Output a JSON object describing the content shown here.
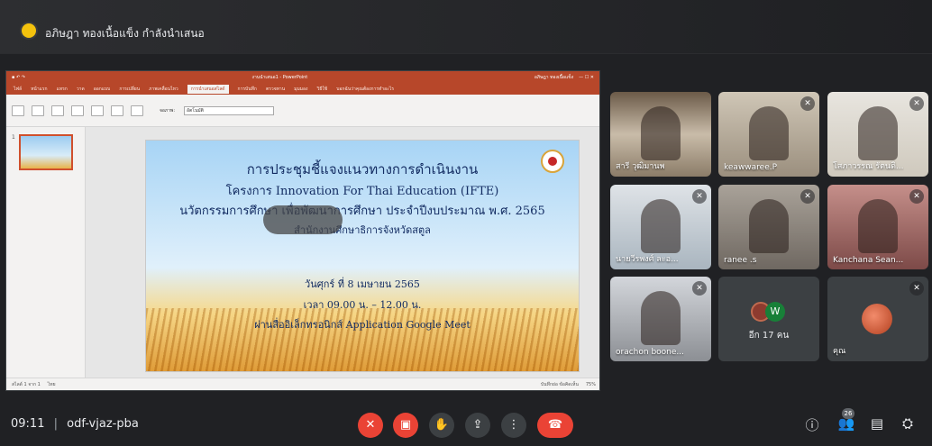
{
  "banner": {
    "presenter_text": "อภิษฎา ทองเนื้อแข็ง กำลังนำเสนอ"
  },
  "powerpoint": {
    "title": "งานนำเสนอ1 - PowerPoint",
    "user": "อภิษฎา ทองเนื้อแข็ง",
    "tabs": [
      "ไฟล์",
      "หน้าแรก",
      "แทรก",
      "วาด",
      "ออกแบบ",
      "การเปลี่ยน",
      "ภาพเคลื่อนไหว",
      "การนำเสนอสไลด์",
      "การบันทึก",
      "ตรวจทาน",
      "มุมมอง",
      "วิธีใช้",
      "บอกฉันว่าคุณต้องการทำอะไร"
    ],
    "ribbon_select_label": "จอภาพ:",
    "ribbon_select_value": "อัตโนมัติ",
    "thumbnail_number": "1",
    "status_left": "สไลด์ 1 จาก 1",
    "status_lang": "ไทย",
    "status_right": "บันทึกย่อ  ข้อคิดเห็น",
    "zoom": "75%"
  },
  "slide": {
    "line1": "การประชุมชี้แจงแนวทางการดำเนินงาน",
    "line2": "โครงการ Innovation For Thai Education (IFTE)",
    "line3": "นวัตกรรมการศึกษา เพื่อพัฒนาการศึกษา ประจำปีงบประมาณ พ.ศ. 2565",
    "line4": "สำนักงานศึกษาธิการจังหวัดสตูล",
    "line5": "วันศุกร์ ที่ 8 เมษายน 2565",
    "line6": "เวลา 09.00 น. – 12.00 น.",
    "line7": "ผ่านสื่ออิเล็กทรอนิกส์ Application Google Meet"
  },
  "participants": [
    {
      "name": "สารี วุฒิมานพ",
      "muted": false
    },
    {
      "name": "keawwaree.P",
      "muted": true
    },
    {
      "name": "โสภาวรรณ รัตนดิ...",
      "muted": true
    },
    {
      "name": "นายวีรพงศ์ ละอ...",
      "muted": true
    },
    {
      "name": "ranee .s",
      "muted": true
    },
    {
      "name": "Kanchana Sean...",
      "muted": true
    },
    {
      "name": "orachon boone...",
      "muted": true
    },
    {
      "name": "อีก 17 คน",
      "muted": false,
      "avatar_letter": "W"
    },
    {
      "name": "คุณ",
      "muted": true
    }
  ],
  "bottom_bar": {
    "time": "09:11",
    "separator": "|",
    "meeting_code": "odf-vjaz-pba",
    "people_count": "26"
  },
  "icons": {
    "mic_off": "mic-off-icon",
    "cam_off": "camera-off-icon",
    "hand": "raise-hand-icon",
    "present": "present-icon",
    "more": "more-icon",
    "hangup": "hangup-icon",
    "info": "info-icon",
    "people": "people-icon",
    "chat": "chat-icon",
    "activities": "activities-icon"
  },
  "colors": {
    "accent_red": "#ea4335",
    "ppt_red": "#b7472a",
    "bg": "#202124"
  }
}
